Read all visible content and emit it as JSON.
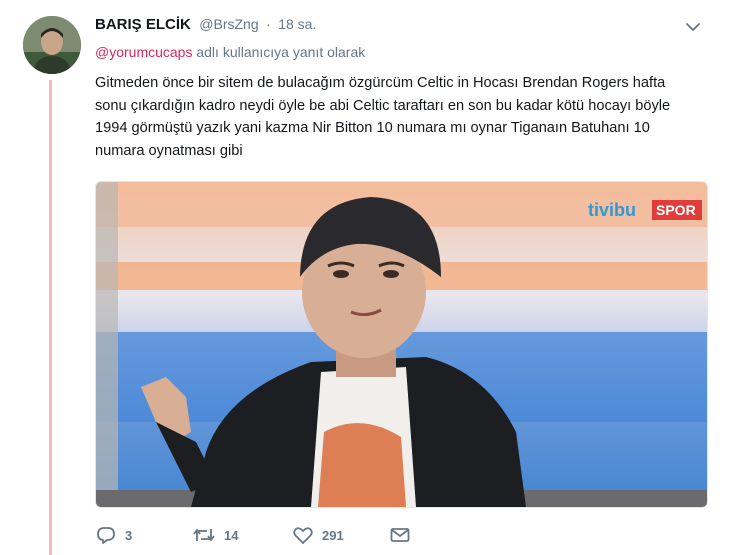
{
  "tweet": {
    "display_name": "BARIŞ ELCİK",
    "handle": "@BrsZng",
    "separator": "·",
    "time": "18 sa.",
    "reply_mention": "@yorumcucaps",
    "reply_suffix": " adlı kullanıcıya yanıt olarak",
    "text": "Gitmeden önce bir sitem de bulacağım özgürcüm Celtic in Hocası Brendan Rogers hafta sonu çıkardığın kadro neydi öyle be abi Celtic taraftarı en son bu kadar kötü hocayı böyle 1994 görmüştü yazık yani kazma Nir Bitton 10 numara mı oynar Tiganaın Batuhanı 10 numara oynatması gibi"
  },
  "media": {
    "channel_logo": "tivibu",
    "channel_tag": "SPOR"
  },
  "actions": {
    "reply_count": "3",
    "retweet_count": "14",
    "like_count": "291"
  },
  "icons": {
    "caret": "chevron-down-icon",
    "reply": "reply-icon",
    "retweet": "retweet-icon",
    "like": "heart-icon",
    "dm": "envelope-icon"
  },
  "colors": {
    "mention": "#e0245e",
    "thread_line": "#f5b8c4",
    "muted": "#657786"
  }
}
